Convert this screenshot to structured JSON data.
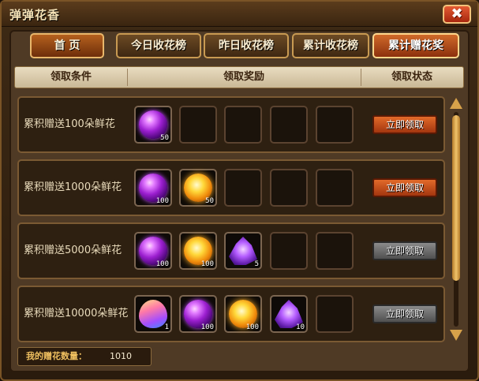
{
  "window": {
    "title": "弹弹花香",
    "close_label": "✖"
  },
  "tabs": [
    {
      "label": "首 页"
    },
    {
      "label": "今日收花榜"
    },
    {
      "label": "昨日收花榜"
    },
    {
      "label": "累计收花榜"
    },
    {
      "label": "累计赠花奖"
    }
  ],
  "headers": {
    "condition": "领取条件",
    "reward": "领取奖励",
    "status": "领取状态"
  },
  "rows": [
    {
      "condition": "累积赠送100朵鲜花",
      "items": [
        {
          "icon": "purple-orb",
          "qty": "50"
        }
      ],
      "button": "立即领取",
      "button_state": "active"
    },
    {
      "condition": "累积赠送1000朵鲜花",
      "items": [
        {
          "icon": "purple-orb",
          "qty": "100"
        },
        {
          "icon": "gold-orb",
          "qty": "50"
        }
      ],
      "button": "立即领取",
      "button_state": "active"
    },
    {
      "condition": "累积赠送5000朵鲜花",
      "items": [
        {
          "icon": "purple-orb",
          "qty": "100"
        },
        {
          "icon": "gold-orb",
          "qty": "100"
        },
        {
          "icon": "purple-crystal",
          "qty": "5"
        }
      ],
      "button": "立即领取",
      "button_state": "disabled"
    },
    {
      "condition": "累积赠送10000朵鲜花",
      "items": [
        {
          "icon": "rainbow-egg",
          "qty": "1"
        },
        {
          "icon": "purple-orb",
          "qty": "100"
        },
        {
          "icon": "gold-orb",
          "qty": "100"
        },
        {
          "icon": "purple-crystal",
          "qty": "10"
        }
      ],
      "button": "立即领取",
      "button_state": "disabled"
    }
  ],
  "footer": {
    "label": "我的赠花数量：",
    "value": "1010"
  },
  "colors": {
    "accent": "#d06a2a",
    "disabled": "#6a6a6a",
    "gold": "#f0c060"
  }
}
